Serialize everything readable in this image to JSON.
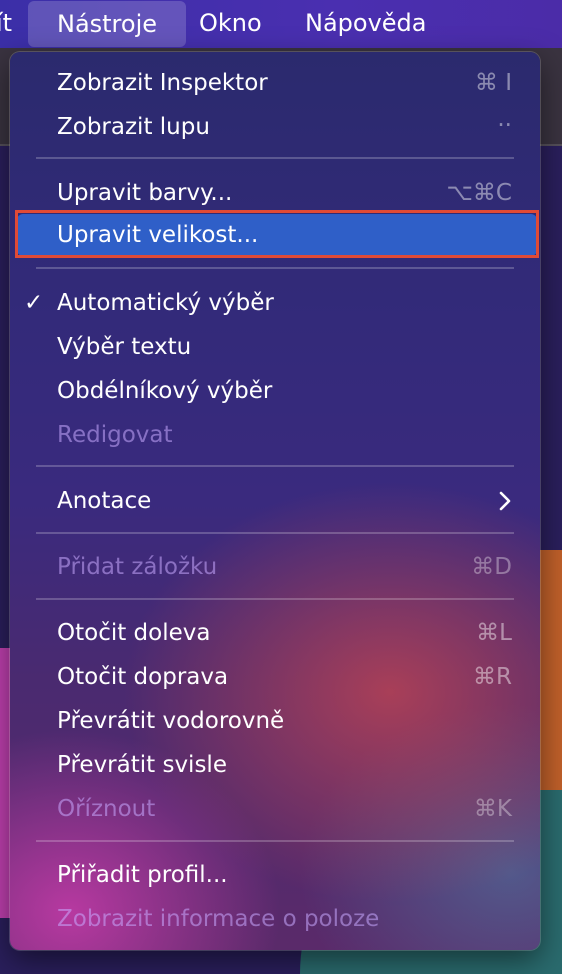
{
  "menubar": {
    "prev_label": "ít",
    "active_label": "Nástroje",
    "okno_label": "Okno",
    "napoveda_label": "Nápověda"
  },
  "menu": {
    "show_inspector": {
      "label": "Zobrazit Inspektor",
      "shortcut": "⌘ I"
    },
    "show_loupe": {
      "label": "Zobrazit lupu",
      "shortcut": ".."
    },
    "adjust_colors": {
      "label": "Upravit barvy...",
      "shortcut": "⌥⌘C"
    },
    "adjust_size": {
      "label": "Upravit velikost..."
    },
    "auto_selection": {
      "label": "Automatický výběr",
      "check": "✓",
      "checked": true
    },
    "text_selection": {
      "label": "Výběr textu"
    },
    "rect_selection": {
      "label": "Obdélníkový výběr"
    },
    "redact": {
      "label": "Redigovat",
      "disabled": true
    },
    "annotate": {
      "label": "Anotace"
    },
    "add_bookmark": {
      "label": "Přidat záložku",
      "shortcut": "⌘D",
      "disabled": true
    },
    "rotate_left": {
      "label": "Otočit doleva",
      "shortcut": "⌘L"
    },
    "rotate_right": {
      "label": "Otočit doprava",
      "shortcut": "⌘R"
    },
    "flip_horizontal": {
      "label": "Převrátit vodorovně"
    },
    "flip_vertical": {
      "label": "Převrátit svisle"
    },
    "crop": {
      "label": "Oříznout",
      "shortcut": "⌘K",
      "disabled": true
    },
    "assign_profile": {
      "label": "Přiřadit profil..."
    },
    "show_location_info": {
      "label": "Zobrazit informace o poloze",
      "disabled": true
    }
  },
  "colors": {
    "highlight": "#2f5fc8",
    "annotation_outline": "#e04a36"
  }
}
